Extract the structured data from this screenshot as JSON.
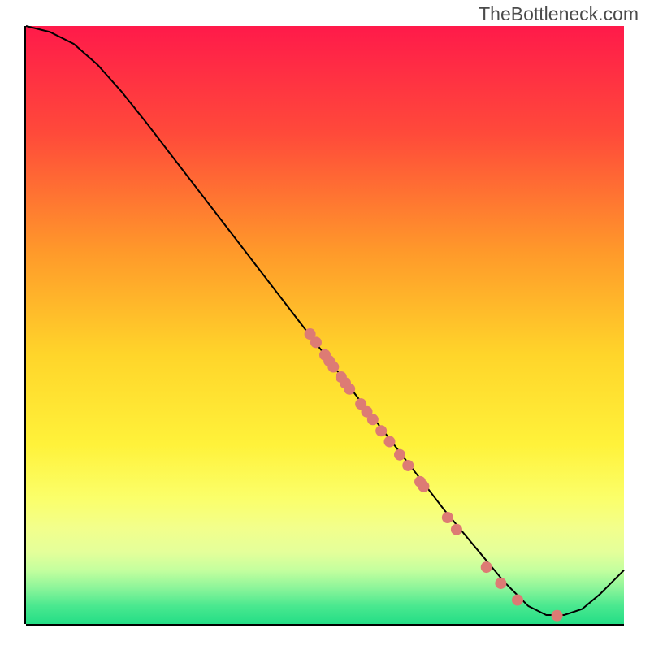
{
  "watermark": "TheBottleneck.com",
  "chart_data": {
    "type": "line",
    "title": "",
    "xlabel": "",
    "ylabel": "",
    "xlim": [
      0,
      100
    ],
    "ylim": [
      0,
      100
    ],
    "gradient_colors": {
      "top": "#ff1a4a",
      "upper_mid": "#ff8a2a",
      "mid": "#ffe72a",
      "lower_mid": "#f9ff88",
      "band": "#d8ff9a",
      "bottom": "#2ae58a"
    },
    "curve": [
      {
        "x": 0,
        "y": 100
      },
      {
        "x": 4,
        "y": 99
      },
      {
        "x": 8,
        "y": 97
      },
      {
        "x": 12,
        "y": 93.5
      },
      {
        "x": 16,
        "y": 89
      },
      {
        "x": 20,
        "y": 84
      },
      {
        "x": 25,
        "y": 77.5
      },
      {
        "x": 30,
        "y": 71
      },
      {
        "x": 35,
        "y": 64.5
      },
      {
        "x": 40,
        "y": 58
      },
      {
        "x": 45,
        "y": 51.5
      },
      {
        "x": 50,
        "y": 45
      },
      {
        "x": 55,
        "y": 38.5
      },
      {
        "x": 60,
        "y": 32
      },
      {
        "x": 65,
        "y": 25.5
      },
      {
        "x": 70,
        "y": 19
      },
      {
        "x": 75,
        "y": 13
      },
      {
        "x": 80,
        "y": 7
      },
      {
        "x": 84,
        "y": 3
      },
      {
        "x": 87,
        "y": 1.5
      },
      {
        "x": 90,
        "y": 1.5
      },
      {
        "x": 93,
        "y": 2.5
      },
      {
        "x": 96,
        "y": 5
      },
      {
        "x": 100,
        "y": 9
      }
    ],
    "dots": [
      {
        "x": 47.5,
        "y": 48.5
      },
      {
        "x": 48.5,
        "y": 47.1
      },
      {
        "x": 50.0,
        "y": 45.0
      },
      {
        "x": 50.7,
        "y": 44.0
      },
      {
        "x": 51.4,
        "y": 43.0
      },
      {
        "x": 52.7,
        "y": 41.3
      },
      {
        "x": 53.4,
        "y": 40.3
      },
      {
        "x": 54.1,
        "y": 39.3
      },
      {
        "x": 56.0,
        "y": 36.8
      },
      {
        "x": 57.0,
        "y": 35.5
      },
      {
        "x": 58.0,
        "y": 34.2
      },
      {
        "x": 59.4,
        "y": 32.3
      },
      {
        "x": 60.8,
        "y": 30.5
      },
      {
        "x": 62.5,
        "y": 28.3
      },
      {
        "x": 63.9,
        "y": 26.5
      },
      {
        "x": 65.9,
        "y": 23.8
      },
      {
        "x": 66.5,
        "y": 23.0
      },
      {
        "x": 70.5,
        "y": 17.8
      },
      {
        "x": 72.0,
        "y": 15.8
      },
      {
        "x": 77.0,
        "y": 9.5
      },
      {
        "x": 79.4,
        "y": 6.8
      },
      {
        "x": 82.2,
        "y": 4.0
      },
      {
        "x": 88.8,
        "y": 1.4
      }
    ],
    "dot_color": "#dd7b74",
    "dot_radius": 7
  }
}
